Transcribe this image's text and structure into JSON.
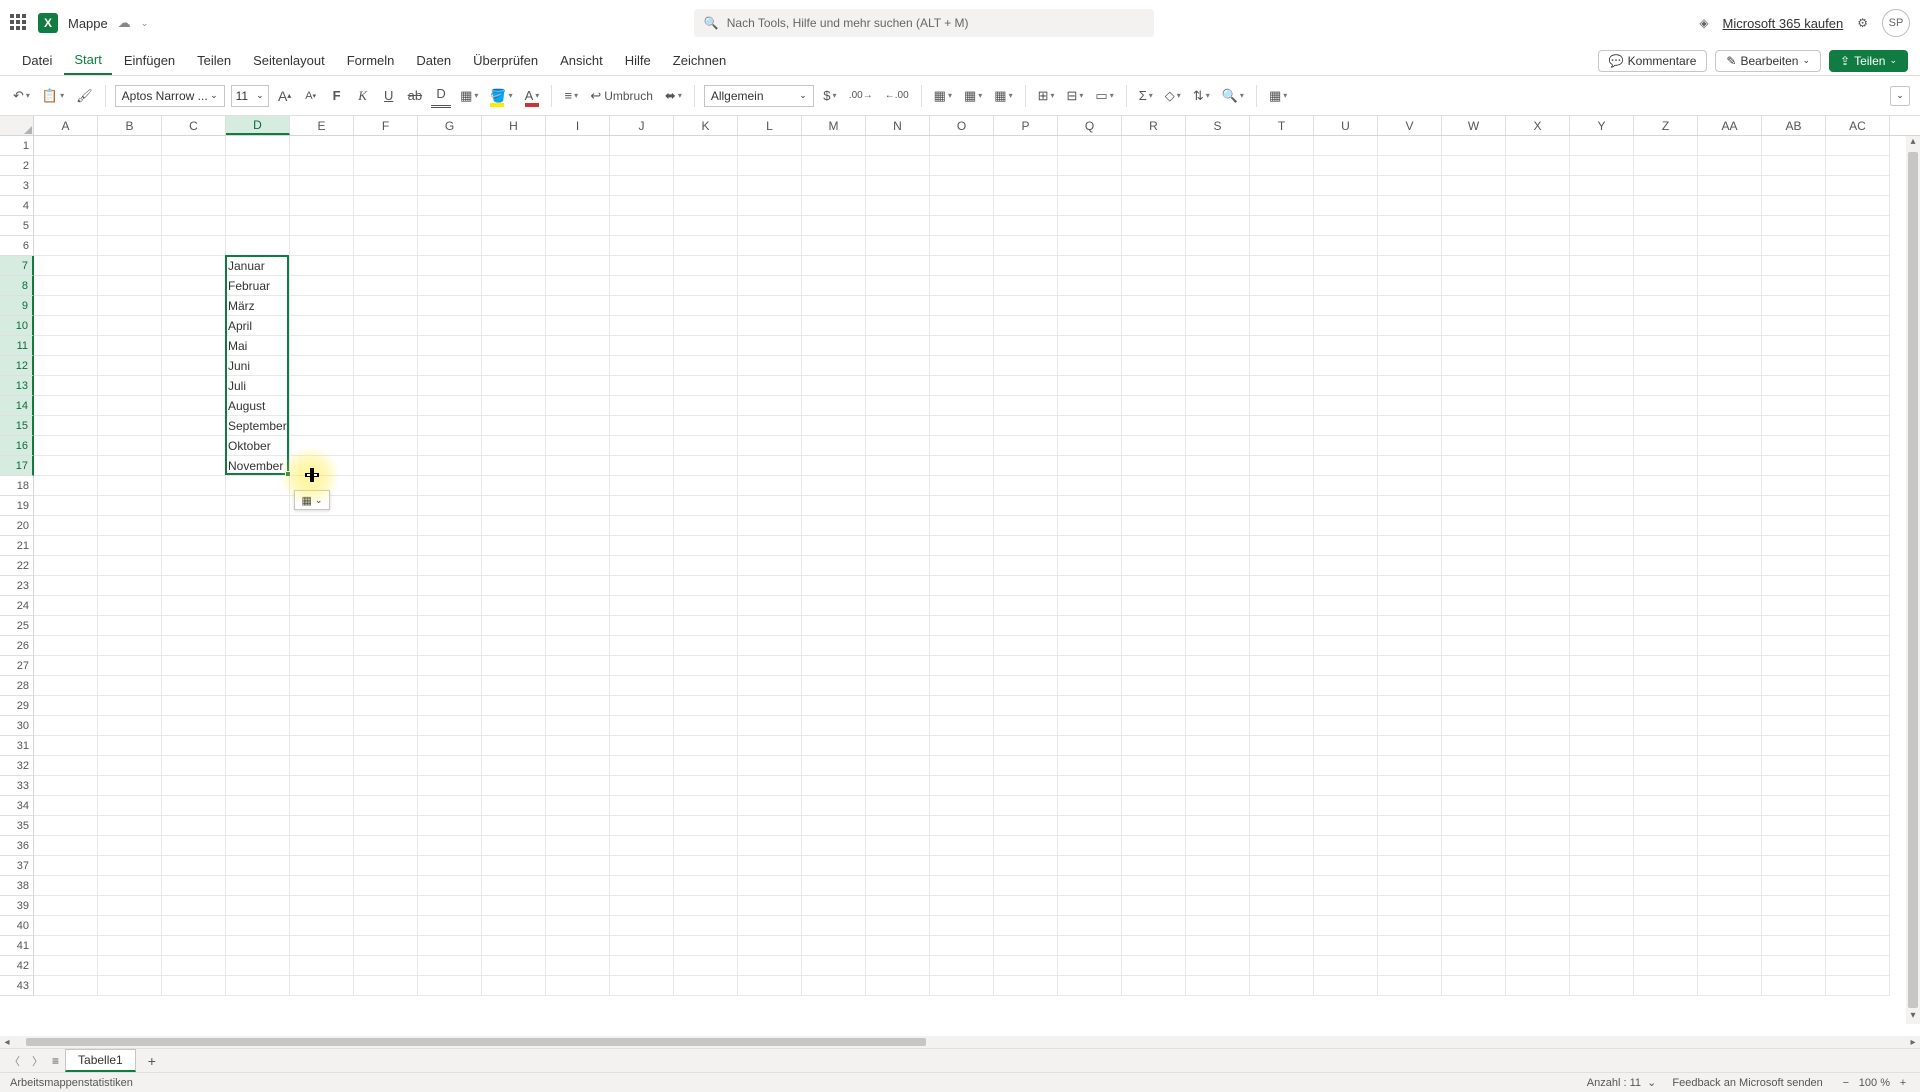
{
  "title": {
    "doc_name": "Mappe"
  },
  "search": {
    "placeholder": "Nach Tools, Hilfe und mehr suchen (ALT + M)"
  },
  "header_right": {
    "buy": "Microsoft 365 kaufen",
    "avatar_initials": "SP"
  },
  "menu": {
    "tabs": [
      "Datei",
      "Start",
      "Einfügen",
      "Teilen",
      "Seitenlayout",
      "Formeln",
      "Daten",
      "Überprüfen",
      "Ansicht",
      "Hilfe",
      "Zeichnen"
    ],
    "active_index": 1,
    "comments": "Kommentare",
    "edit": "Bearbeiten",
    "share": "Teilen"
  },
  "ribbon": {
    "font_name": "Aptos Narrow ...",
    "font_size": "11",
    "wrap": "Umbruch",
    "number_format": "Allgemein"
  },
  "columns": [
    "A",
    "B",
    "C",
    "D",
    "E",
    "F",
    "G",
    "H",
    "I",
    "J",
    "K",
    "L",
    "M",
    "N",
    "O",
    "P",
    "Q",
    "R",
    "S",
    "T",
    "U",
    "V",
    "W",
    "X",
    "Y",
    "Z",
    "AA",
    "AB",
    "AC"
  ],
  "selected_col_index": 3,
  "rows_count": 43,
  "selected_rows": {
    "start": 7,
    "end": 17
  },
  "cell_data": {
    "D7": "Januar",
    "D8": "Februar",
    "D9": "März",
    "D10": "April",
    "D11": "Mai",
    "D12": "Juni",
    "D13": "Juli",
    "D14": "August",
    "D15": "September",
    "D16": "Oktober",
    "D17": "November"
  },
  "sheet": {
    "name": "Tabelle1"
  },
  "status": {
    "stats": "Arbeitsmappenstatistiken",
    "count_label": "Anzahl :",
    "count_value": "11",
    "feedback": "Feedback an Microsoft senden",
    "zoom": "100 %"
  }
}
